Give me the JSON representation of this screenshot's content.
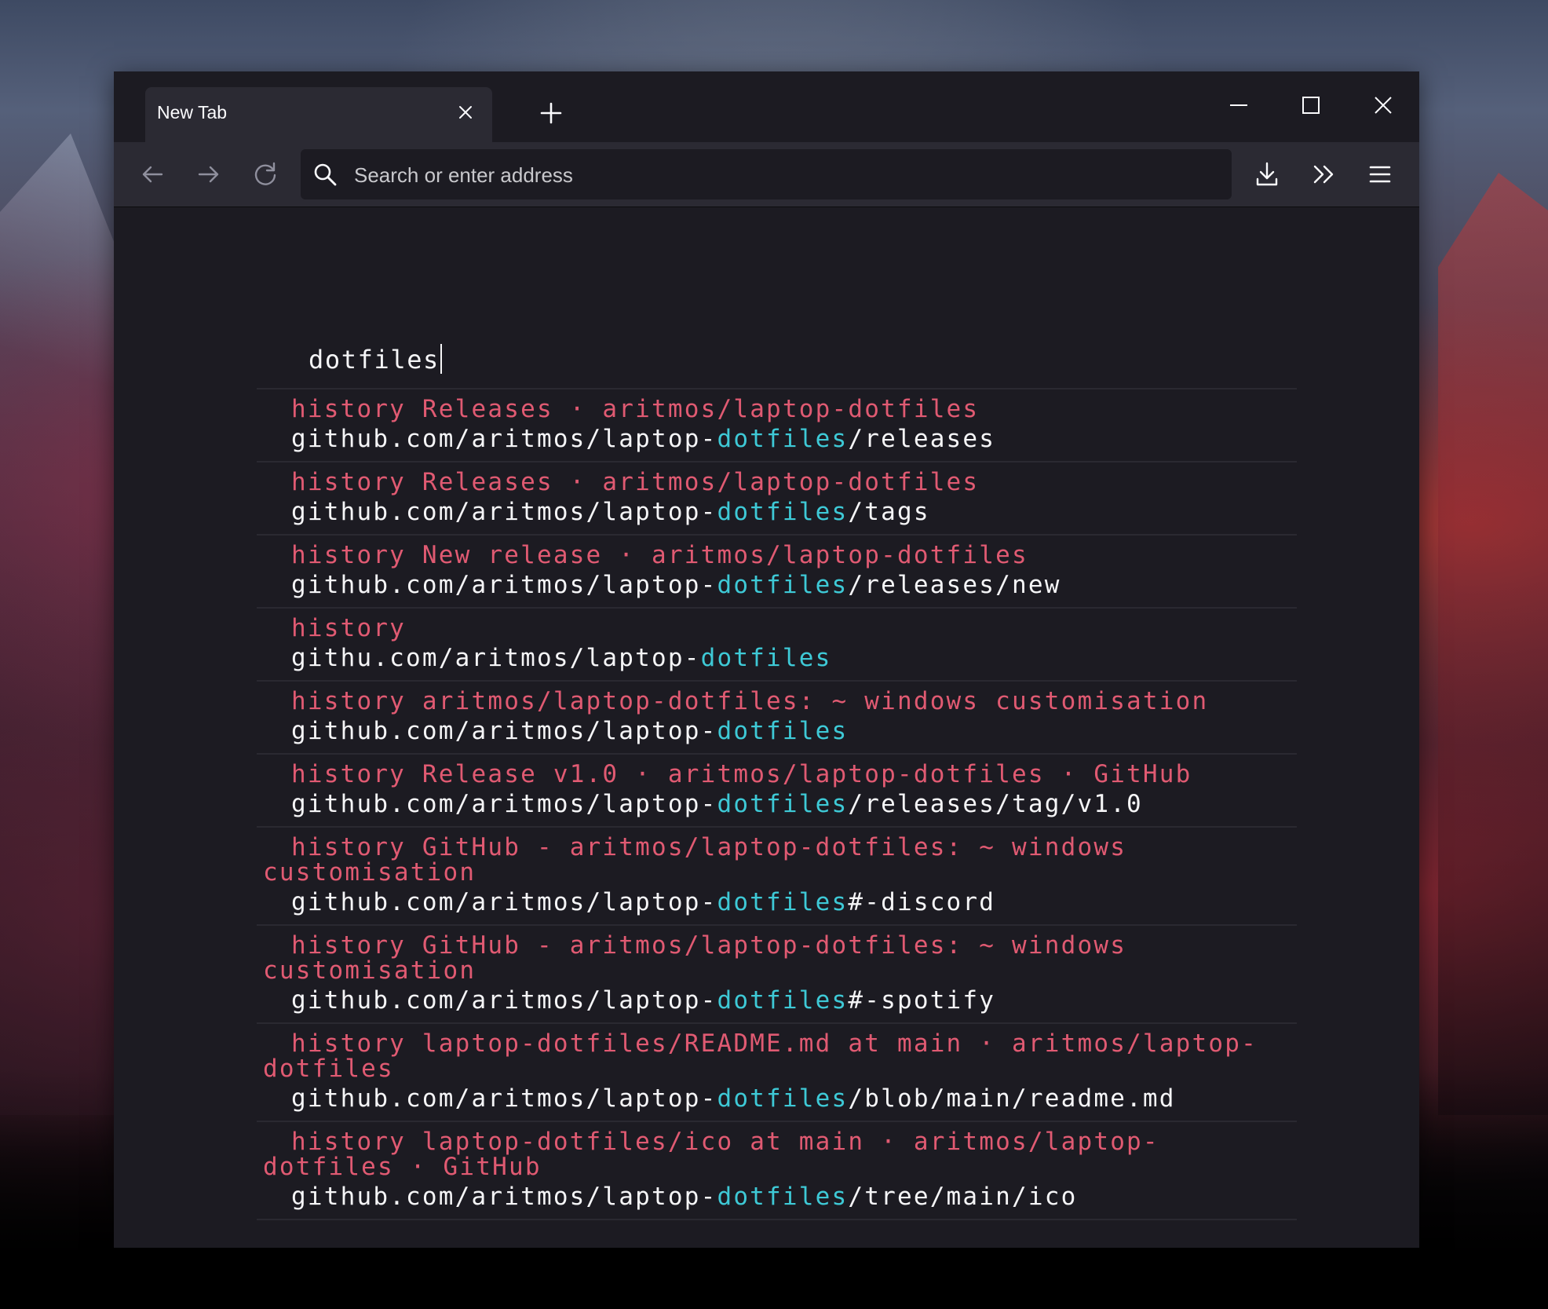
{
  "browser": {
    "tab_title": "New Tab",
    "url_placeholder": "Search or enter address"
  },
  "icons": {
    "back": "arrow-left-icon",
    "forward": "arrow-right-icon",
    "reload": "reload-icon",
    "search": "search-icon",
    "downloads": "download-icon",
    "overflow": "chevrons-right-icon",
    "menu": "hamburger-menu-icon"
  },
  "colors": {
    "window_bg": "#1c1b22",
    "toolbar_bg": "#2b2a33",
    "title_text": "#e05a72",
    "highlight": "#3ec9d6",
    "url_text": "#f5f5f7"
  },
  "omnibox": {
    "query": "dotfiles",
    "results": [
      {
        "tag": "history",
        "title": "Releases · aritmos/laptop-dotfiles",
        "url_pre": "github.com/aritmos/laptop-",
        "url_match": "dotfiles",
        "url_post": "/releases"
      },
      {
        "tag": "history",
        "title": "Releases · aritmos/laptop-dotfiles",
        "url_pre": "github.com/aritmos/laptop-",
        "url_match": "dotfiles",
        "url_post": "/tags"
      },
      {
        "tag": "history",
        "title": "New release · aritmos/laptop-dotfiles",
        "url_pre": "github.com/aritmos/laptop-",
        "url_match": "dotfiles",
        "url_post": "/releases/new"
      },
      {
        "tag": "history",
        "title": "",
        "url_pre": "githu.com/aritmos/laptop-",
        "url_match": "dotfiles",
        "url_post": ""
      },
      {
        "tag": "history",
        "title": "aritmos/laptop-dotfiles: ~ windows customisation",
        "url_pre": "github.com/aritmos/laptop-",
        "url_match": "dotfiles",
        "url_post": ""
      },
      {
        "tag": "history",
        "title": "Release v1.0 · aritmos/laptop-dotfiles · GitHub",
        "url_pre": "github.com/aritmos/laptop-",
        "url_match": "dotfiles",
        "url_post": "/releases/tag/v1.0"
      },
      {
        "tag": "history",
        "title": "GitHub - aritmos/laptop-dotfiles: ~ windows customisation",
        "url_pre": "github.com/aritmos/laptop-",
        "url_match": "dotfiles",
        "url_post": "#-discord"
      },
      {
        "tag": "history",
        "title": "GitHub - aritmos/laptop-dotfiles: ~ windows customisation",
        "url_pre": "github.com/aritmos/laptop-",
        "url_match": "dotfiles",
        "url_post": "#-spotify"
      },
      {
        "tag": "history",
        "title": "laptop-dotfiles/README.md at main · aritmos/laptop-dotfiles",
        "url_pre": "github.com/aritmos/laptop-",
        "url_match": "dotfiles",
        "url_post": "/blob/main/readme.md"
      },
      {
        "tag": "history",
        "title": "laptop-dotfiles/ico at main · aritmos/laptop-dotfiles · GitHub",
        "url_pre": "github.com/aritmos/laptop-",
        "url_match": "dotfiles",
        "url_post": "/tree/main/ico"
      }
    ]
  }
}
